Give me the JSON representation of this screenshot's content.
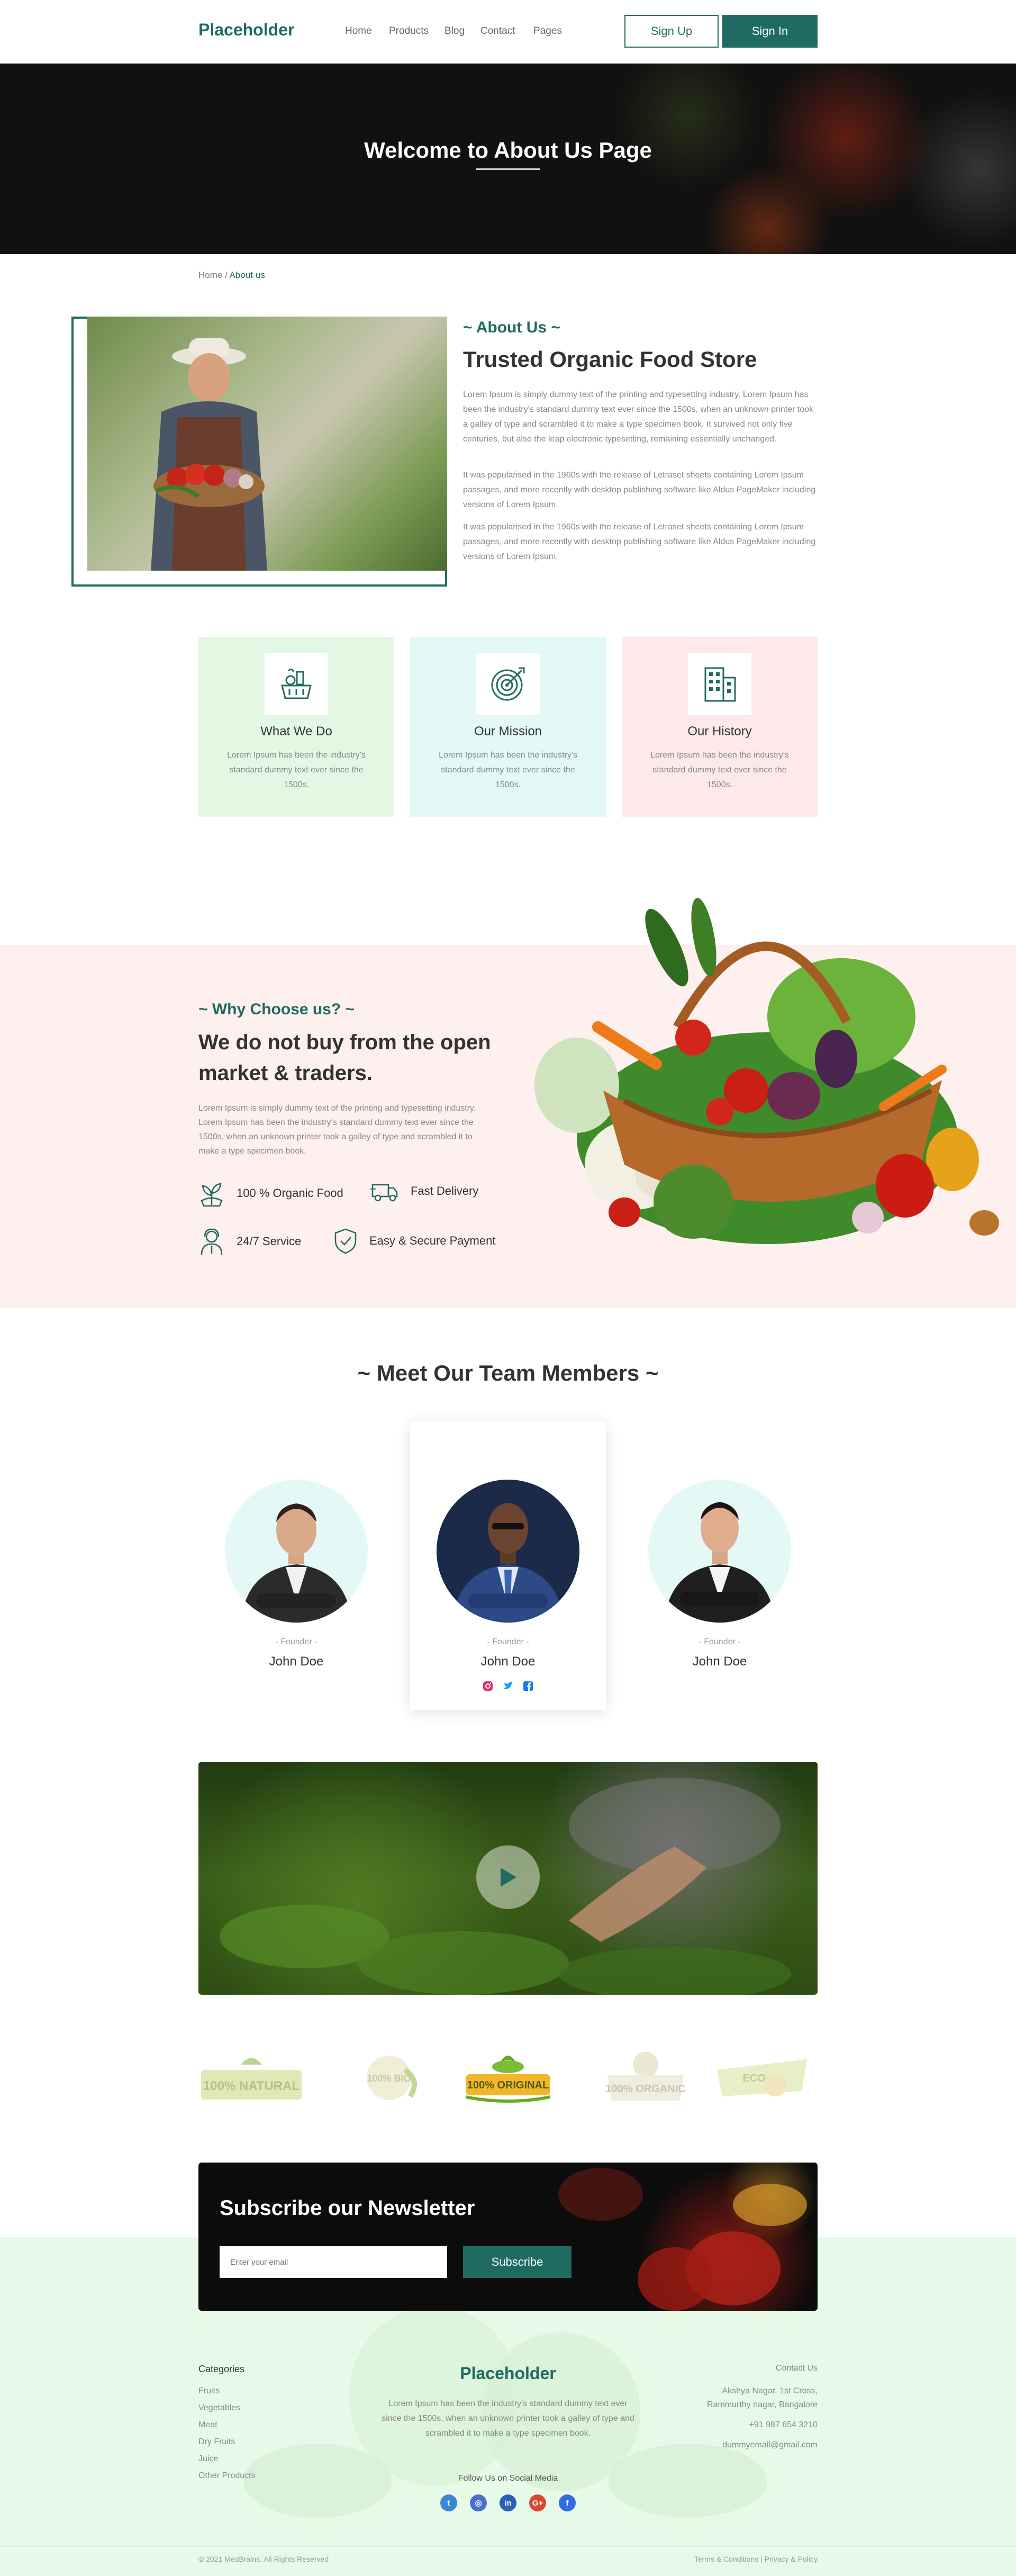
{
  "nav": {
    "logo": "Placeholder",
    "links": [
      "Home",
      "Products",
      "Blog",
      "Contact",
      "Pages"
    ],
    "signup": "Sign Up",
    "signin": "Sign In"
  },
  "hero": {
    "title": "Welcome to About Us Page"
  },
  "breadcrumb": {
    "home": "Home",
    "sep": " / ",
    "current": "About us"
  },
  "about": {
    "subtitle": "~ About Us ~",
    "title": "Trusted Organic Food Store",
    "paragraphs": [
      "Lorem Ipsum is simply dummy text of the printing and typesetting industry. Lorem Ipsum has been the industry's standard dummy text ever since the 1500s, when an unknown printer took a galley of type and scrambled it to make a type specimen book. It survived not only five centuries, but also the leap electronic typesetting, remaining essentially unchanged.",
      "It was popularised in the 1960s with the release of Letraset sheets containing Lorem Ipsum passages, and more recently with desktop publishing software like Aldus PageMaker including versions of Lorem Ipsum.",
      "It was popularised in the 1960s with the release of Letraset sheets containing Lorem Ipsum passages, and more recently with desktop publishing software like Aldus PageMaker including versions of Lorem Ipsum."
    ]
  },
  "cards": [
    {
      "title": "What We Do",
      "text": "Lorem Ipsum has been the industry's standard dummy text ever since the 1500s.",
      "icon": "basket-icon",
      "bg": "#e3f8e3"
    },
    {
      "title": "Our Mission",
      "text": "Lorem Ipsum has been the industry's standard dummy text ever since the 1500s.",
      "icon": "target-icon",
      "bg": "#e2f9f6"
    },
    {
      "title": "Our History",
      "text": "Lorem Ipsum has been the industry's standard dummy text ever since the 1500s.",
      "icon": "building-icon",
      "bg": "#fde8ec"
    }
  ],
  "why": {
    "subtitle": "~ Why Choose us? ~",
    "title": "We do not buy from the open market & traders.",
    "text": "Lorem Ipsum is simply dummy text of the printing and typesetting industry. Lorem Ipsum has been the industry's standard dummy text ever since the 1500s, when an unknown printer took a galley of type and scrambled it to make a type specimen book.",
    "features": [
      {
        "label": "100 % Organic Food",
        "icon": "organic-plant-icon"
      },
      {
        "label": "Fast Delivery",
        "icon": "delivery-truck-icon"
      },
      {
        "label": "24/7 Service",
        "icon": "support-agent-icon"
      },
      {
        "label": "Easy & Secure Payment",
        "icon": "secure-shield-icon"
      }
    ]
  },
  "team": {
    "title": "~ Meet Our Team Members ~",
    "members": [
      {
        "role": "- Founder -",
        "name": "John Doe"
      },
      {
        "role": "- Founder -",
        "name": "John Doe"
      },
      {
        "role": "- Founder -",
        "name": "John Doe"
      }
    ]
  },
  "badges": [
    "100% NATURAL",
    "100% BIO",
    "100% ORIGINAL",
    "100% ORGANIC",
    "ECO"
  ],
  "newsletter": {
    "title": "Subscribe our Newsletter",
    "placeholder": "Enter your email",
    "button": "Subscribe"
  },
  "footer": {
    "categories_title": "Categories",
    "categories": [
      "Fruits",
      "Vegetables",
      "Meat",
      "Dry Fruits",
      "Juice",
      "Other Products"
    ],
    "brand": "Placeholder",
    "description": "Lorem Ipsum has been the industry's standard dummy text ever since the 1500s, when an unknown printer took a galley of type and scrambled it to make a type specimen book.",
    "follow": "Follow Us on Social Media",
    "contact_title": "Contact Us",
    "address_line1": "Akshya Nagar, 1st Cross,",
    "address_line2": "Rammurthy nagar, Bangalore",
    "phone": "+91 987 654 3210",
    "email": "dummyemail@gmail.com",
    "copyright": "© 2021 MedBrains. All Rights Reserved",
    "legal": "Terms & Conditions | Privacy & Policy"
  },
  "colors": {
    "accent": "#1f6b61",
    "why_bg": "#fdf0ee",
    "footer_bg": "#e7fae8"
  }
}
